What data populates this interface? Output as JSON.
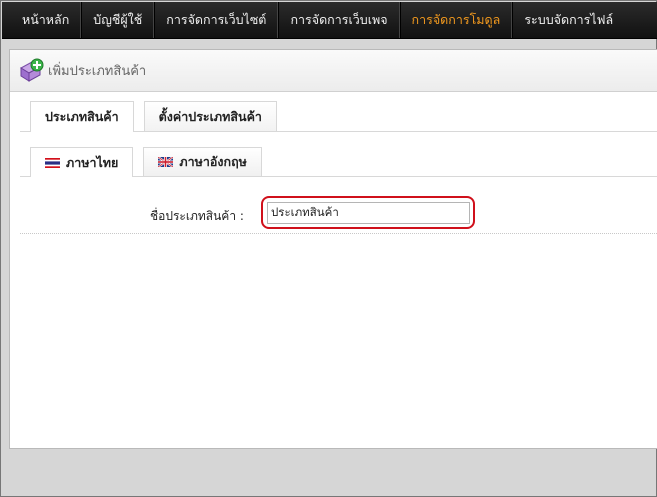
{
  "nav": {
    "items": [
      {
        "label": "หน้าหลัก",
        "active": false
      },
      {
        "label": "บัญชีผู้ใช้",
        "active": false
      },
      {
        "label": "การจัดการเว็บไซต์",
        "active": false
      },
      {
        "label": "การจัดการเว็บเพจ",
        "active": false
      },
      {
        "label": "การจัดการโมดูล",
        "active": true
      },
      {
        "label": "ระบบจัดการไฟล์",
        "active": false
      }
    ],
    "active_color": "#f39a1e"
  },
  "panel": {
    "title": "เพิ่มประเภทสินค้า",
    "icon": "add-category-icon"
  },
  "tabs": [
    {
      "label": "ประเภทสินค้า",
      "active": true
    },
    {
      "label": "ตั้งค่าประเภทสินค้า",
      "active": false
    }
  ],
  "language_tabs": [
    {
      "label": "ภาษาไทย",
      "flag": "thai-flag-icon",
      "active": true
    },
    {
      "label": "ภาษาอังกฤษ",
      "flag": "uk-flag-icon",
      "active": false
    }
  ],
  "form": {
    "name_label": "ชื่อประเภทสินค้า :",
    "name_value": "ประเภทสินค้า",
    "highlight_color": "#d0101b"
  }
}
